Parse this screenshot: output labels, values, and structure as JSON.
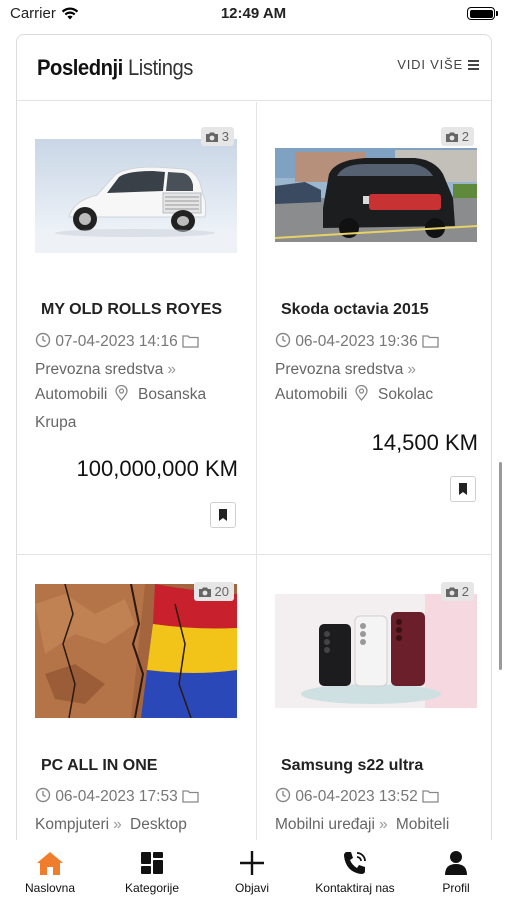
{
  "status_bar": {
    "carrier": "Carrier",
    "time": "12:49 AM"
  },
  "section": {
    "title_strong": "Poslednji",
    "title_light": "Listings",
    "see_more": "VIDI VIŠE"
  },
  "listings": [
    {
      "title": "MY OLD ROLLS ROYES",
      "photos": "3",
      "date": "07-04-2023 14:16",
      "category": "Prevozna sredstva",
      "subcategory": "Automobili",
      "location": "Bosanska Krupa",
      "price": "100,000,000 KM",
      "image": "white-luxury-car"
    },
    {
      "title": "Skoda octavia 2015",
      "photos": "2",
      "date": "06-04-2023 19:36",
      "category": "Prevozna sredstva",
      "subcategory": "Automobili",
      "location": "Sokolac",
      "price": "14,500 KM",
      "image": "black-station-wagon"
    },
    {
      "title": "PC ALL IN ONE",
      "photos": "20",
      "date": "06-04-2023 17:53",
      "category": "Kompjuteri",
      "subcategory": "Desktop",
      "image": "cracked-flag"
    },
    {
      "title": "Samsung s22 ultra",
      "photos": "2",
      "date": "06-04-2023 13:52",
      "category": "Mobilni uređaji",
      "subcategory": "Mobiteli",
      "image": "three-phones"
    }
  ],
  "tabs": [
    {
      "label": "Naslovna",
      "icon": "home-icon",
      "active": true
    },
    {
      "label": "Kategorije",
      "icon": "grid-icon"
    },
    {
      "label": "Objavi",
      "icon": "plus-icon"
    },
    {
      "label": "Kontaktiraj nas",
      "icon": "phone-icon"
    },
    {
      "label": "Profil",
      "icon": "user-icon"
    }
  ],
  "colors": {
    "accent": "#f07d2b",
    "text": "#222222",
    "muted": "#777777"
  }
}
